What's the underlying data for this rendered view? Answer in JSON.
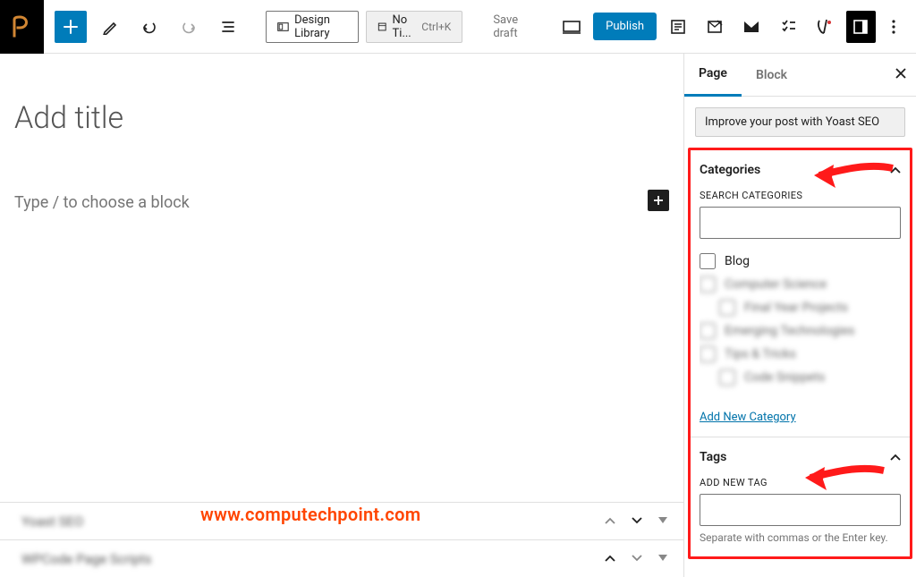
{
  "toolbar": {
    "design_library_label": "Design Library",
    "template_label": "No Ti...",
    "template_shortcut": "Ctrl+K",
    "save_draft_label": "Save draft",
    "publish_label": "Publish"
  },
  "editor": {
    "title_placeholder": "Add title",
    "body_placeholder": "Type / to choose a block"
  },
  "metaboxes": [
    {
      "title": "Yoast SEO"
    },
    {
      "title": "WPCode Page Scripts"
    }
  ],
  "sidebar": {
    "tabs": {
      "page": "Page",
      "block": "Block"
    },
    "yoast_button": "Improve your post with Yoast SEO",
    "categories": {
      "heading": "Categories",
      "search_label": "SEARCH CATEGORIES",
      "items": [
        {
          "label": "Blog",
          "clear": true,
          "indent": false
        },
        {
          "label": "Computer Science",
          "clear": false,
          "indent": false
        },
        {
          "label": "Final Year Projects",
          "clear": false,
          "indent": true
        },
        {
          "label": "Emerging Technologies",
          "clear": false,
          "indent": false
        },
        {
          "label": "Tips & Tricks",
          "clear": false,
          "indent": false
        },
        {
          "label": "Code Snippets",
          "clear": false,
          "indent": true
        }
      ],
      "add_link": "Add New Category"
    },
    "tags": {
      "heading": "Tags",
      "add_label": "ADD NEW TAG",
      "help": "Separate with commas or the Enter key."
    }
  },
  "watermark": "www.computechpoint.com"
}
